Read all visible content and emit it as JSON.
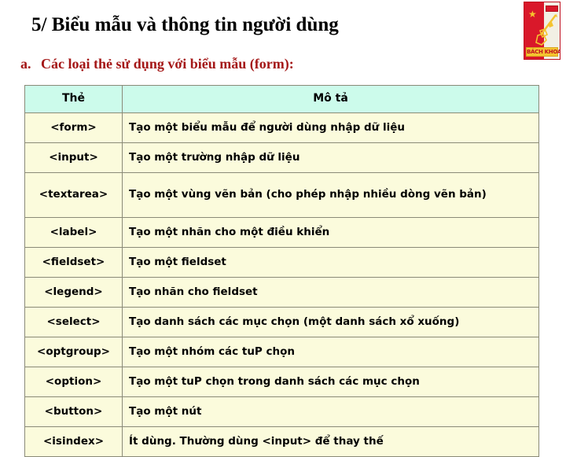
{
  "slide": {
    "title": "5/ Biểu mẫu và thông tin người dùng",
    "subtitle_marker": "a.",
    "subtitle": "Các loại thẻ sử dụng với biểu mẫu (form):",
    "colors": {
      "title_text": "#000000",
      "subtitle_text": "#a41717",
      "table_header_bg": "#ccfbeb",
      "table_body_bg": "#fbfbdc",
      "table_border": "#8a8a78",
      "logo_red": "#d9182a",
      "logo_yellow": "#f4c430"
    }
  },
  "logo": {
    "name": "bach-khoa-university-logo",
    "caption": "BÁCH KHOA",
    "star_glyph": "★"
  },
  "table": {
    "columns": [
      "Thẻ",
      "Mô tả"
    ],
    "rows": [
      {
        "tag": "<form>",
        "desc": "Tạo một biểu mẫu để người dùng nhập dữ liệu",
        "tall": false
      },
      {
        "tag": "<input>",
        "desc": "Tạo một trường nhập dữ liệu",
        "tall": false
      },
      {
        "tag": "<textarea>",
        "desc": "Tạo một vùng  vẽn bản (cho  phép  nhập nhiều dòng  vẽn bản)",
        "tall": true
      },
      {
        "tag": "<label>",
        "desc": "Tạo một nhãn cho một điều khiển",
        "tall": false
      },
      {
        "tag": "<fieldset>",
        "desc": "Tạo một fieldset",
        "tall": false
      },
      {
        "tag": "<legend>",
        "desc": "Tạo nhãn cho fieldset",
        "tall": false
      },
      {
        "tag": "<select>",
        "desc": "Tạo danh sách các mục chọn (một danh sách xổ xuống)",
        "tall": false
      },
      {
        "tag": "<optgroup>",
        "desc": "Tạo một nhóm các tuP chọn",
        "tall": false
      },
      {
        "tag": "<option>",
        "desc": "Tạo một tuP chọn trong danh sách các mục chọn",
        "tall": false
      },
      {
        "tag": "<button>",
        "desc": "Tạo một nút",
        "tall": false
      },
      {
        "tag": "<isindex>",
        "desc": "Ít dùng. Thường dùng <input> để thay thế",
        "tall": false
      }
    ]
  }
}
